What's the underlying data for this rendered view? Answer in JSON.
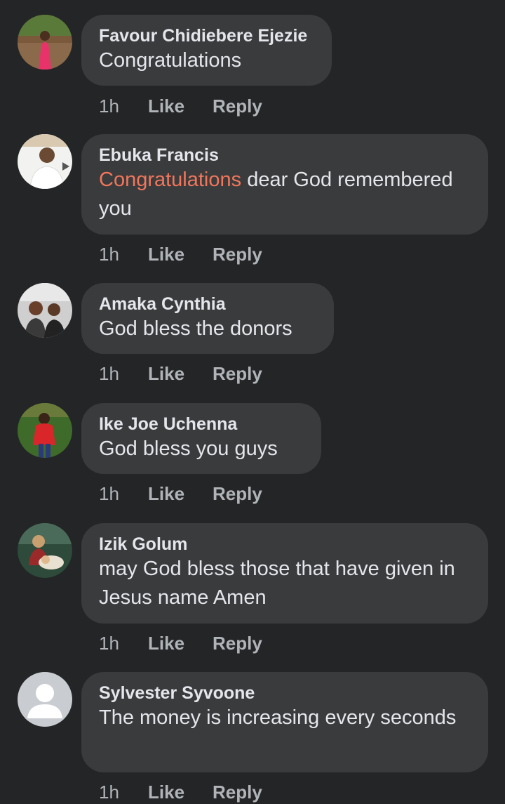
{
  "comments": [
    {
      "author": "Favour Chidiebere Ejezie",
      "mention": "",
      "text": "Congratulations",
      "time": "1h",
      "like_label": "Like",
      "reply_label": "Reply",
      "avatar_icon": "profile-photo-icon"
    },
    {
      "author": "Ebuka Francis",
      "mention": "Congratulations",
      "text": " dear God remembered you",
      "time": "1h",
      "like_label": "Like",
      "reply_label": "Reply",
      "avatar_icon": "profile-photo-icon"
    },
    {
      "author": "Amaka Cynthia",
      "mention": "",
      "text": "God bless the donors",
      "time": "1h",
      "like_label": "Like",
      "reply_label": "Reply",
      "avatar_icon": "profile-photo-icon"
    },
    {
      "author": "Ike Joe Uchenna",
      "mention": "",
      "text": "God bless you guys",
      "time": "1h",
      "like_label": "Like",
      "reply_label": "Reply",
      "avatar_icon": "profile-photo-icon"
    },
    {
      "author": "Izik Golum",
      "mention": "",
      "text": "may God bless those that have given in Jesus name Amen",
      "time": "1h",
      "like_label": "Like",
      "reply_label": "Reply",
      "avatar_icon": "profile-photo-icon"
    },
    {
      "author": "Sylvester Syvoone",
      "mention": "",
      "text": "The money is increasing every seconds",
      "time": "1h",
      "like_label": "Like",
      "reply_label": "Reply",
      "avatar_icon": "default-user-icon"
    }
  ],
  "colors": {
    "background": "#242526",
    "bubble": "#3a3b3c",
    "text": "#e4e6eb",
    "secondary_text": "#b0b3b8",
    "mention": "#f0765c"
  }
}
